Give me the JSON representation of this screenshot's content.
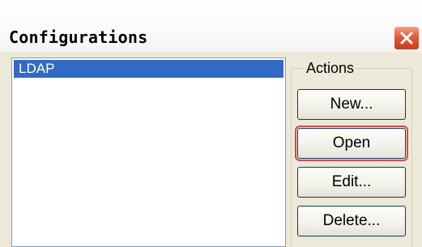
{
  "window": {
    "title": "Configurations",
    "close_icon": "close-icon"
  },
  "configurations_list": {
    "items": [
      {
        "label": "LDAP",
        "selected": true
      }
    ]
  },
  "actions": {
    "group_label": "Actions",
    "buttons": [
      {
        "label": "New..."
      },
      {
        "label": "Open",
        "focused": true
      },
      {
        "label": "Edit..."
      },
      {
        "label": "Delete..."
      }
    ]
  },
  "colors": {
    "selection": "#316ac5",
    "focus_highlight": "#d9464b",
    "close_button": "#e2603b",
    "dialog_background": "#ece9d8"
  }
}
